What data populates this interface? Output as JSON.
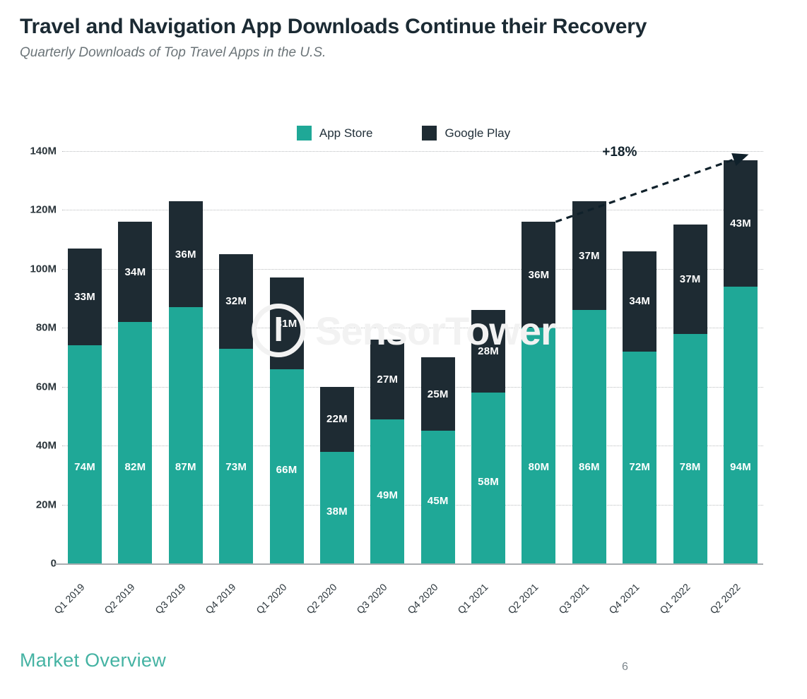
{
  "header": {
    "title": "Travel and Navigation App Downloads Continue their Recovery",
    "subtitle": "Quarterly Downloads of Top Travel Apps in the U.S."
  },
  "footer": {
    "section_label": "Market Overview",
    "page_number": "6"
  },
  "watermark": {
    "text": "SensorTower"
  },
  "colors": {
    "app_store": "#1fa897",
    "google_play": "#1e2b33",
    "accent_teal": "#45b3a3",
    "gridline": "#b9bcbe",
    "text_dark": "#1b2a33",
    "text_muted": "#6b7478"
  },
  "chart_data": {
    "type": "bar",
    "stacked": true,
    "title": "Travel and Navigation App Downloads Continue their Recovery",
    "subtitle": "Quarterly Downloads of Top Travel Apps in the U.S.",
    "xlabel": "",
    "ylabel": "",
    "ylim": [
      0,
      140
    ],
    "yticks": [
      0,
      20,
      40,
      60,
      80,
      100,
      120,
      140
    ],
    "ytick_labels": [
      "0",
      "20M",
      "40M",
      "60M",
      "80M",
      "100M",
      "120M",
      "140M"
    ],
    "grid": true,
    "legend_position": "top-center",
    "units": "millions of downloads",
    "categories": [
      "Q1 2019",
      "Q2 2019",
      "Q3 2019",
      "Q4 2019",
      "Q1 2020",
      "Q2 2020",
      "Q3 2020",
      "Q4 2020",
      "Q1 2021",
      "Q2 2021",
      "Q3 2021",
      "Q4 2021",
      "Q1 2022",
      "Q2 2022"
    ],
    "series": [
      {
        "name": "App Store",
        "color": "#1fa897",
        "values": [
          74,
          82,
          87,
          73,
          66,
          38,
          49,
          45,
          58,
          80,
          86,
          72,
          78,
          94
        ],
        "labels": [
          "74M",
          "82M",
          "87M",
          "73M",
          "66M",
          "38M",
          "49M",
          "45M",
          "58M",
          "80M",
          "86M",
          "72M",
          "78M",
          "94M"
        ]
      },
      {
        "name": "Google Play",
        "color": "#1e2b33",
        "values": [
          33,
          34,
          36,
          32,
          31,
          22,
          27,
          25,
          28,
          36,
          37,
          34,
          37,
          43
        ],
        "labels": [
          "33M",
          "34M",
          "36M",
          "32M",
          "31M",
          "22M",
          "27M",
          "25M",
          "28M",
          "36M",
          "37M",
          "34M",
          "37M",
          "43M"
        ]
      }
    ],
    "totals": [
      107,
      116,
      123,
      105,
      97,
      60,
      76,
      70,
      86,
      116,
      123,
      106,
      115,
      137
    ],
    "annotations": [
      {
        "text": "+18%",
        "type": "arrow",
        "from_category": "Q2 2021",
        "to_category": "Q2 2022",
        "from_value": 116,
        "to_value": 137,
        "style": "dashed"
      }
    ]
  }
}
